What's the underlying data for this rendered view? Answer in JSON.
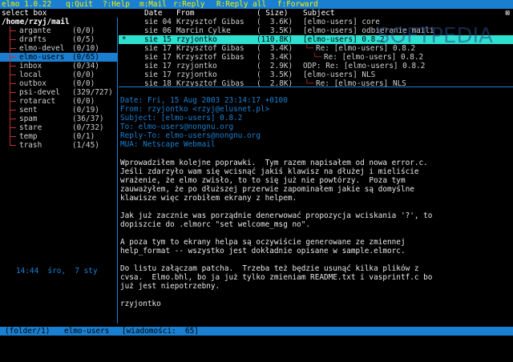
{
  "topbar": {
    "app": "elmo 1.0.22",
    "keys": [
      "q:Quit",
      "?:Help",
      "m:Mail",
      "r:Reply",
      "R:Reply all",
      "f:Forward"
    ]
  },
  "sidebar": {
    "label": "select box",
    "root": "/home/rzyj/mail",
    "folders": [
      {
        "name": "argante",
        "count": "(0/0)"
      },
      {
        "name": "drafts",
        "count": "(0/5)"
      },
      {
        "name": "elmo-devel",
        "count": "(0/10)"
      },
      {
        "name": "elmo-users",
        "count": "(0/65)",
        "selected": true
      },
      {
        "name": "inbox",
        "count": "(0/34)"
      },
      {
        "name": "local",
        "count": "(0/0)"
      },
      {
        "name": "outbox",
        "count": "(0/0)"
      },
      {
        "name": "psi-devel",
        "count": "(329/727)"
      },
      {
        "name": "rotaract",
        "count": "(0/0)"
      },
      {
        "name": "sent",
        "count": "(0/19)"
      },
      {
        "name": "spam",
        "count": "(36/37)"
      },
      {
        "name": "stare",
        "count": "(0/732)"
      },
      {
        "name": "temp",
        "count": "(0/1)"
      },
      {
        "name": "trash",
        "count": "(1/45)"
      }
    ],
    "clock": "14:44  śro,  7 sty"
  },
  "list": {
    "columns": {
      "date": "Date",
      "from": "From",
      "size": "(  Size)",
      "subject": "Subject"
    },
    "rows": [
      {
        "mark": "",
        "date": "sie 04",
        "from": "Krzysztof Gibas",
        "size": "(  3.6K)",
        "subject": "[elmo-users] core",
        "thread": ""
      },
      {
        "mark": "",
        "date": "sie 06",
        "from": "Marcin Cylke",
        "size": "(  3.5K)",
        "subject": "[elmo-users] odbieranie maili",
        "thread": ""
      },
      {
        "mark": "*",
        "date": "sie 15",
        "from": "rzyjontko",
        "size": "(110.8K)",
        "subject": "[elmo-users] 0.8.2",
        "thread": "",
        "selected": true
      },
      {
        "mark": "",
        "date": "sie 17",
        "from": "Krzysztof Gibas",
        "size": "(  3.4K)",
        "subject": "Re: [elmo-users] 0.8.2",
        "thread": "1"
      },
      {
        "mark": "",
        "date": "sie 17",
        "from": "Krzysztof Gibas",
        "size": "(  3.4K)",
        "subject": "Re: [elmo-users] 0.8.2",
        "thread": "2"
      },
      {
        "mark": "",
        "date": "sie 17",
        "from": "rzyjontko",
        "size": "(  2.9K)",
        "subject": "ODP: Re: [elmo-users] 0.8.2",
        "thread": ""
      },
      {
        "mark": "",
        "date": "sie 17",
        "from": "rzyjontko",
        "size": "(  3.5K)",
        "subject": "[elmo-users] NLS",
        "thread": ""
      },
      {
        "mark": "",
        "date": "sie 18",
        "from": "Krzysztof Gibas",
        "size": "(  2.8K)",
        "subject": "Re: [elmo-users] NLS",
        "thread": "1"
      }
    ]
  },
  "message": {
    "headers": [
      "Date: Fri, 15 Aug 2003 23:14:17 +0100",
      "From: rzyjontko <rzyj@elusnet.pl>",
      "Subject: [elmo-users] 0.8.2",
      "To: elmo-users@nongnu.org",
      "Reply-To: elmo-users@nongnu.org",
      "MUA: Netscape Webmail"
    ],
    "paragraphs": [
      "Wprowadziłem kolejne poprawki.  Tym razem napisałem od nowa error.c.\nJeśli zdarzyło wam się wcisnąć jakiś klawisz na dłużej i mieliście\nwrażenie, że elmo zwisło, to to się już nie powtórzy.  Poza tym\nzauważyłem, że po dłuższej przerwie zapominałem jakie są domyślne\nklawisze więc zrobiłem ekrany z helpem.",
      "Jak już zacznie was porządnie denerwować propozycja wciskania '?', to\ndopiszcie do .elmorc \"set welcome_msg no\".",
      "A poza tym to ekrany helpa są oczywiście generowane ze zmiennej\nhelp_format -- wszystko jest dokładnie opisane w sample.elmorc.",
      "Do listu załączam patcha.  Trzeba też będzie usunąć kilka plików z\ncvsa.  Elmo.bhl, bo ja już tylko zmieniam README.txt i vasprintf.c bo\njuż jest niepotrzebny.",
      "rzyjontko"
    ]
  },
  "statusbar": {
    "folder": "(folder/1)",
    "name": "elmo-users",
    "count": "[wiadomości:  65]"
  },
  "watermark": "SOFTPEDIA"
}
